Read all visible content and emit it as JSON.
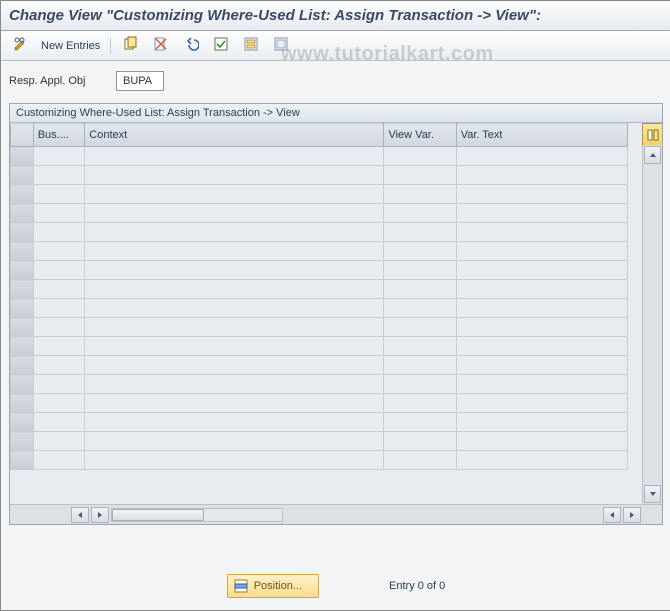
{
  "title": "Change View \"Customizing Where-Used List: Assign Transaction -> View\":",
  "watermark": "www.tutorialkart.com",
  "toolbar": {
    "newEntries": "New Entries"
  },
  "form": {
    "respApplObjLabel": "Resp. Appl. Obj",
    "respApplObjValue": "BUPA"
  },
  "table": {
    "title": "Customizing Where-Used List: Assign Transaction -> View",
    "columns": {
      "bus": "Bus....",
      "context": "Context",
      "viewVar": "View Var.",
      "varText": "Var. Text"
    }
  },
  "footer": {
    "positionBtn": "Position...",
    "entryText": "Entry 0 of 0"
  }
}
